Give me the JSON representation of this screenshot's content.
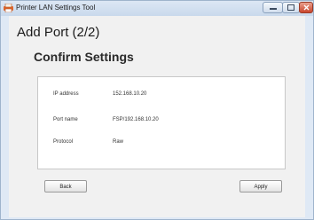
{
  "window": {
    "title": "Printer LAN Settings Tool"
  },
  "icons": {
    "app": "printer-app-icon",
    "minimize": "minimize-icon",
    "maximize": "maximize-icon",
    "close": "close-icon"
  },
  "page": {
    "heading": "Add Port (2/2)",
    "section_heading": "Confirm Settings"
  },
  "settings": [
    {
      "label": "IP address",
      "value": "152.168.10.20"
    },
    {
      "label": "Port name",
      "value": "FSP/192.168.10.20"
    },
    {
      "label": "Protocol",
      "value": "Raw"
    }
  ],
  "buttons": {
    "back_label": "Back",
    "apply_label": "Apply"
  },
  "colors": {
    "close_button": "#c9452c",
    "frame": "#dfe9f5",
    "panel": "#ffffff"
  }
}
